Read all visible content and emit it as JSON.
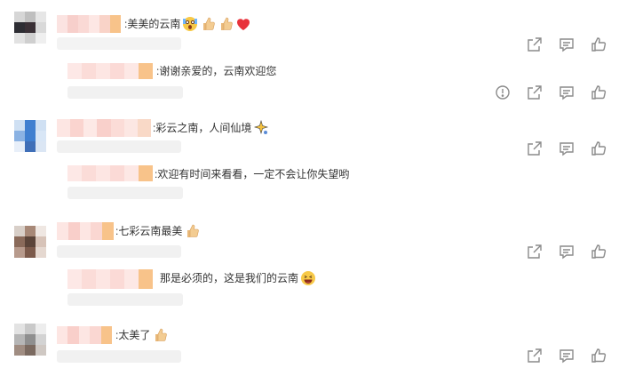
{
  "comments": [
    {
      "text": ":美美的云南",
      "emojis": [
        "shocked-face-icon",
        "thumbs-up-icon",
        "thumbs-up-icon",
        "red-heart-icon"
      ],
      "reply": {
        "text": ":谢谢亲爱的，云南欢迎您",
        "actions": [
          "report-icon",
          "share-icon",
          "comment-icon",
          "like-icon"
        ]
      },
      "actions": [
        "share-icon",
        "comment-icon",
        "like-icon"
      ]
    },
    {
      "text": ":彩云之南，人间仙境",
      "emojis": [
        "sparkle-icon"
      ],
      "reply": {
        "text": ":欢迎有时间来看看，一定不会让你失望哟",
        "actions": []
      },
      "actions": [
        "share-icon",
        "comment-icon",
        "like-icon"
      ]
    },
    {
      "text": ":七彩云南最美",
      "emojis": [
        "thumbs-up-icon"
      ],
      "reply": {
        "text": "那是必须的，这是我们的云南",
        "emojis": [
          "laughing-face-icon"
        ],
        "actions": []
      },
      "actions": [
        "share-icon",
        "comment-icon",
        "like-icon"
      ]
    },
    {
      "text": ":太美了",
      "emojis": [
        "thumbs-up-icon"
      ],
      "actions": [
        "share-icon",
        "comment-icon",
        "like-icon"
      ]
    }
  ],
  "colors": {
    "icon_gray": "#8a8a8a",
    "blur_pink": "#f9d9d6",
    "blur_orange": "#f8c38a",
    "blur_gray": "#efefef"
  }
}
